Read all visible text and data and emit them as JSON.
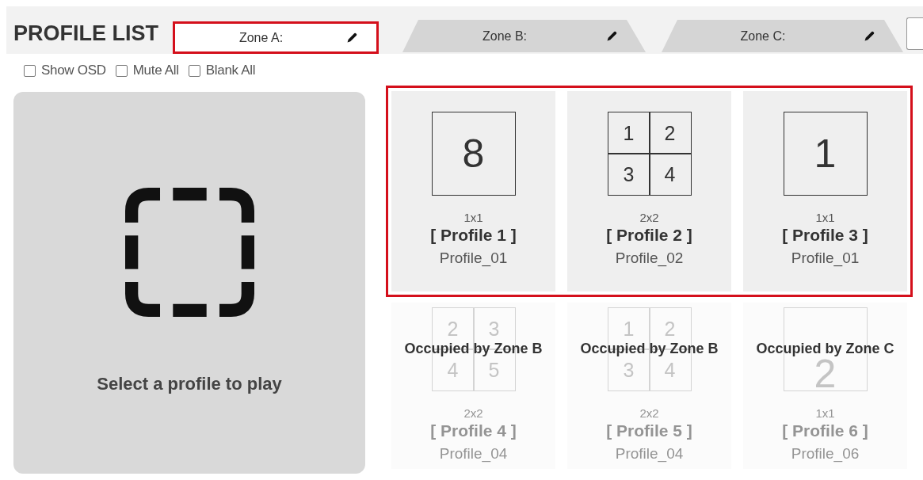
{
  "header": {
    "title": "PROFILE LIST"
  },
  "zones": [
    {
      "label": "Zone A:",
      "selected": true,
      "highlighted": true
    },
    {
      "label": "Zone B:",
      "selected": false,
      "highlighted": false
    },
    {
      "label": "Zone C:",
      "selected": false,
      "highlighted": false
    }
  ],
  "options": [
    {
      "label": "Show OSD",
      "checked": false
    },
    {
      "label": "Mute All",
      "checked": false
    },
    {
      "label": "Blank All",
      "checked": false
    }
  ],
  "player": {
    "message": "Select a profile to play"
  },
  "profile_rows": [
    {
      "highlighted": true,
      "profiles": [
        {
          "layout": "1x1",
          "name": "[ Profile 1 ]",
          "source": "Profile_01",
          "cells": [
            "8"
          ],
          "occupied": false
        },
        {
          "layout": "2x2",
          "name": "[ Profile 2 ]",
          "source": "Profile_02",
          "cells": [
            "1",
            "2",
            "3",
            "4"
          ],
          "occupied": false
        },
        {
          "layout": "1x1",
          "name": "[ Profile 3 ]",
          "source": "Profile_01",
          "cells": [
            "1"
          ],
          "occupied": false
        }
      ]
    },
    {
      "highlighted": false,
      "profiles": [
        {
          "layout": "2x2",
          "name": "[ Profile 4 ]",
          "source": "Profile_04",
          "cells": [
            "2",
            "3",
            "4",
            "5"
          ],
          "occupied": true,
          "occupied_label": "Occupied by Zone B"
        },
        {
          "layout": "2x2",
          "name": "[ Profile 5 ]",
          "source": "Profile_04",
          "cells": [
            "1",
            "2",
            "3",
            "4"
          ],
          "occupied": true,
          "occupied_label": "Occupied by Zone B"
        },
        {
          "layout": "1x1",
          "name": "[ Profile 6 ]",
          "source": "Profile_06",
          "cells": [
            "2"
          ],
          "occupied": true,
          "occupied_label": "Occupied by Zone C"
        }
      ]
    }
  ]
}
